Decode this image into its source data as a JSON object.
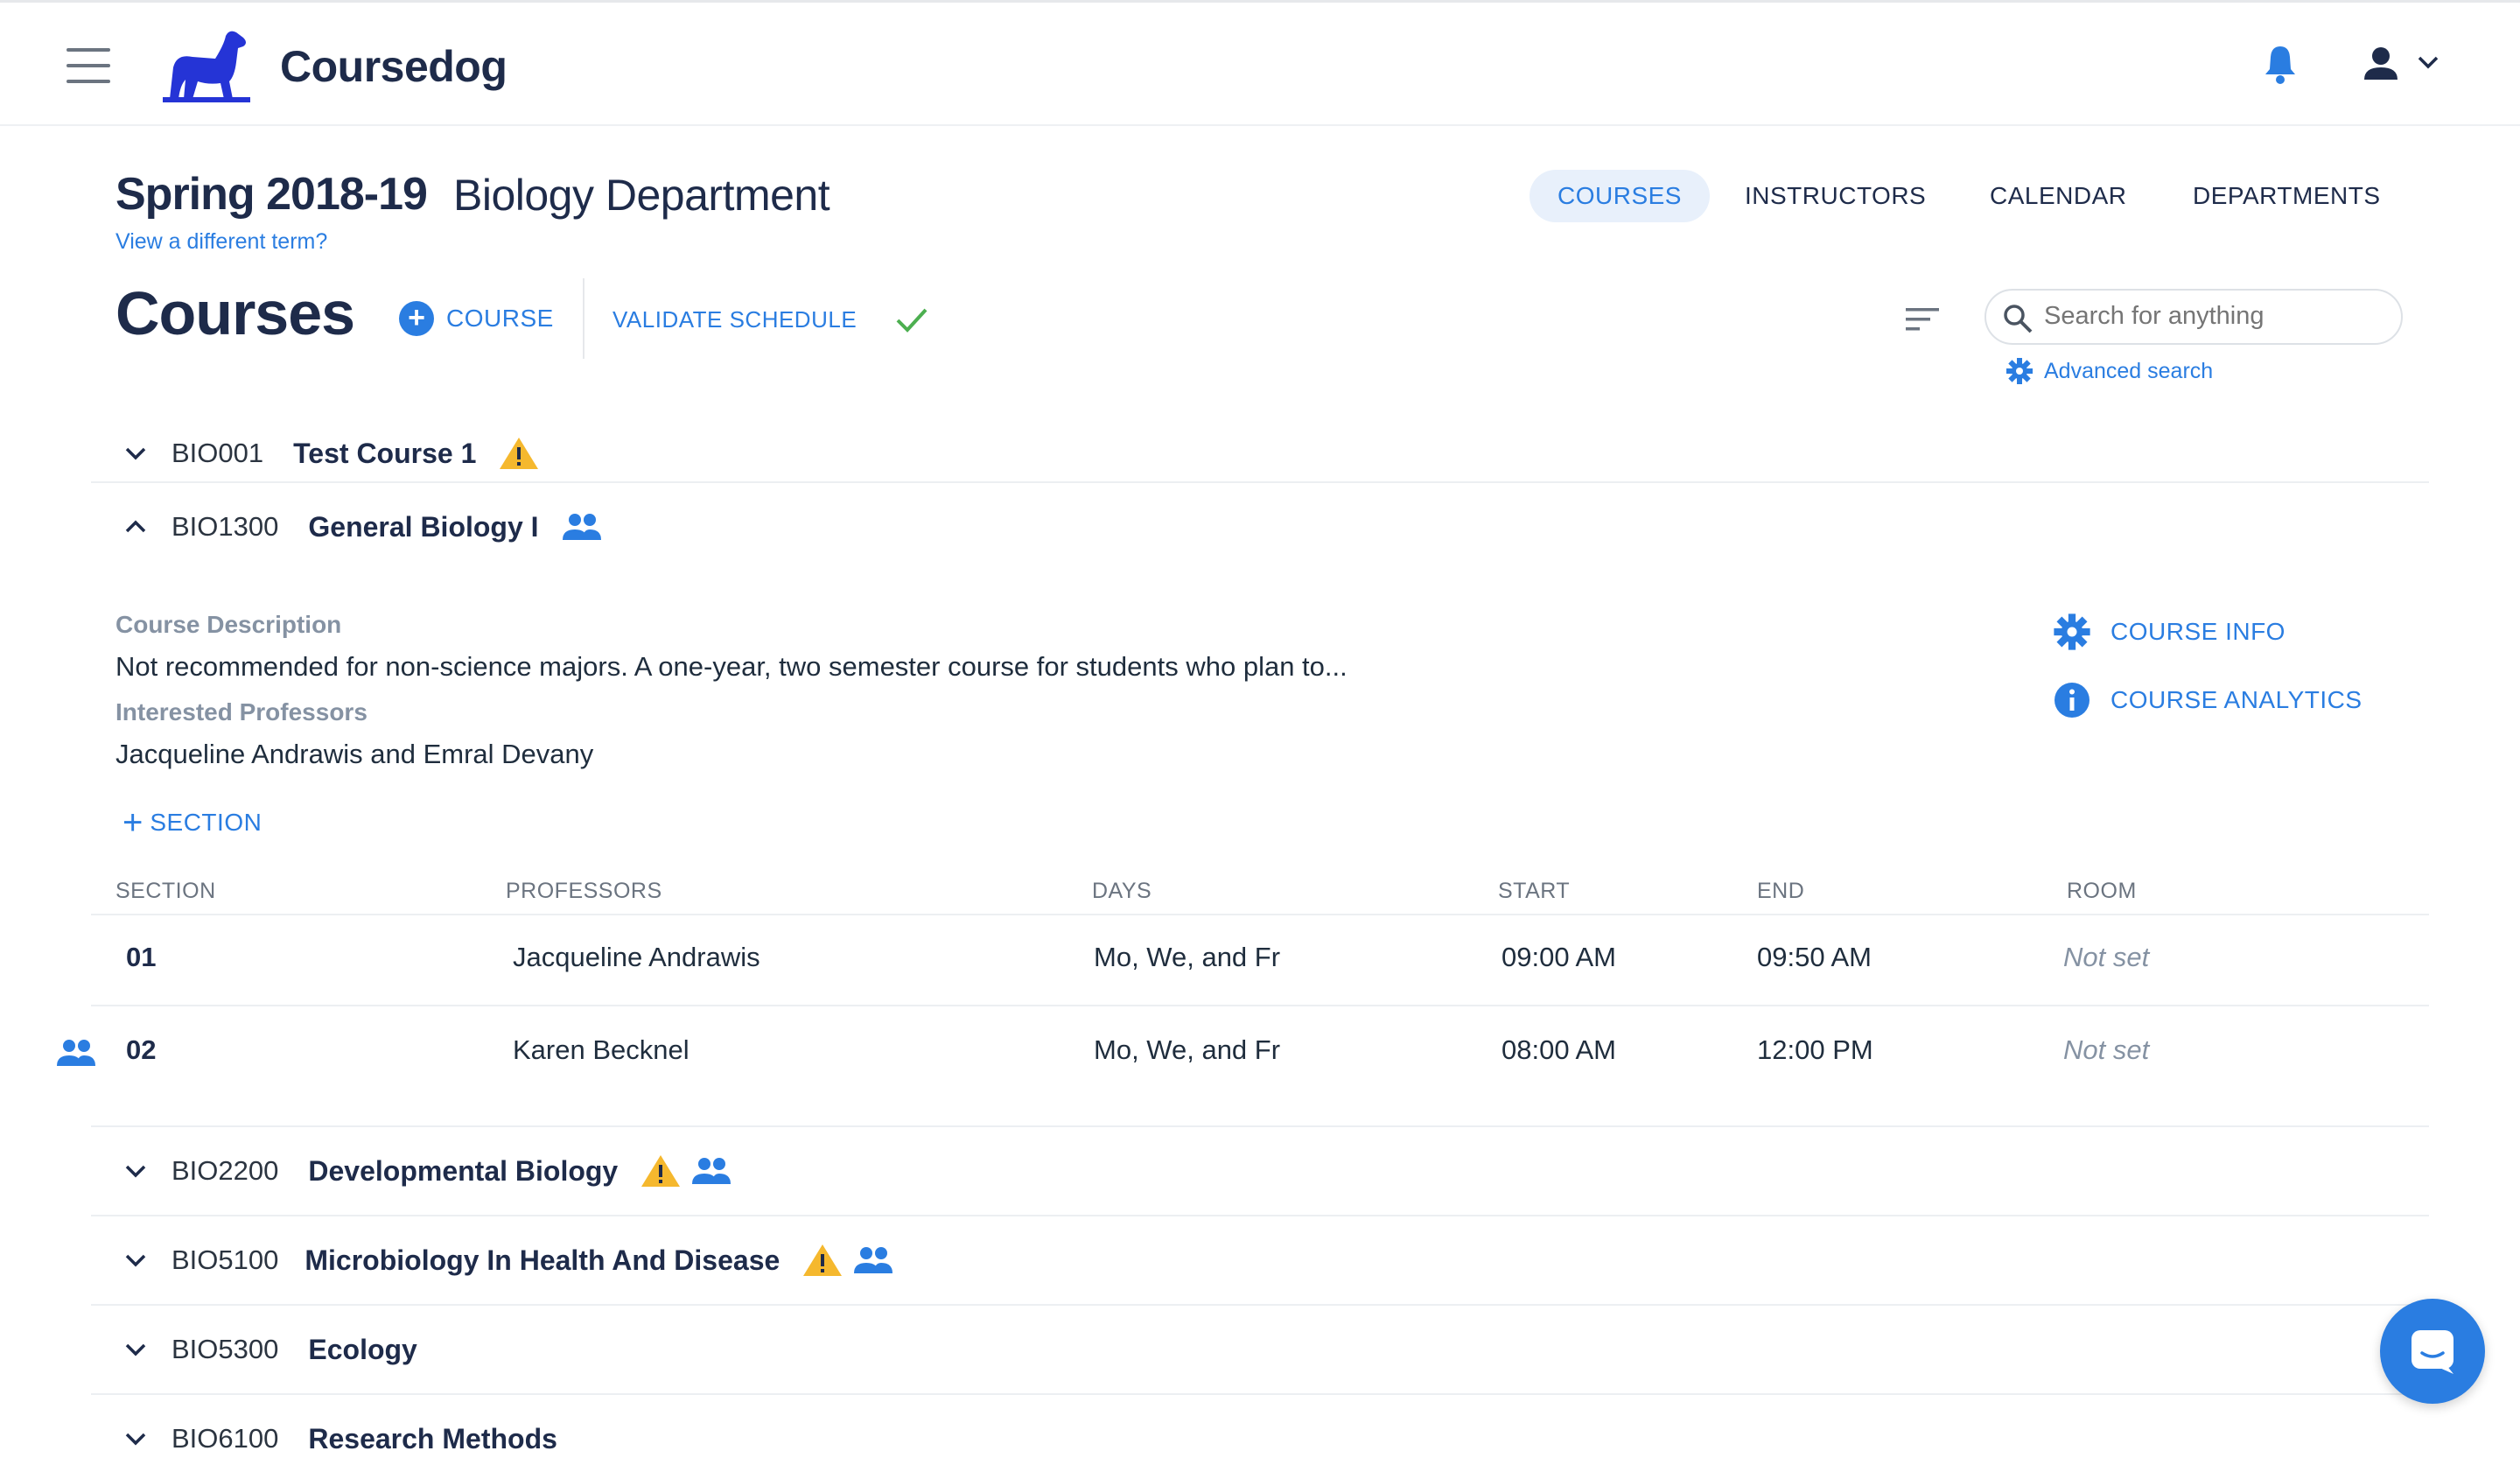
{
  "app": {
    "brand": "Coursedog"
  },
  "header": {
    "term": "Spring 2018-19",
    "department": "Biology Department",
    "change_term_link": "View a different term?",
    "nav": [
      "COURSES",
      "INSTRUCTORS",
      "CALENDAR",
      "DEPARTMENTS"
    ],
    "active_nav": "COURSES"
  },
  "toolbar": {
    "title": "Courses",
    "add_course_label": "COURSE",
    "validate_label": "VALIDATE SCHEDULE",
    "search_placeholder": "Search for anything",
    "advanced_search_label": "Advanced search"
  },
  "courses": [
    {
      "code": "BIO001",
      "name": "Test Course 1",
      "warning": true,
      "group": false,
      "expanded": false
    },
    {
      "code": "BIO1300",
      "name": "General Biology I",
      "warning": false,
      "group": true,
      "expanded": true
    },
    {
      "code": "BIO2200",
      "name": "Developmental Biology",
      "warning": true,
      "group": true,
      "expanded": false
    },
    {
      "code": "BIO5100",
      "name": "Microbiology In Health And Disease",
      "warning": true,
      "group": true,
      "expanded": false
    },
    {
      "code": "BIO5300",
      "name": "Ecology",
      "warning": false,
      "group": false,
      "expanded": false
    },
    {
      "code": "BIO6100",
      "name": "Research Methods",
      "warning": false,
      "group": false,
      "expanded": false
    }
  ],
  "expanded_course": {
    "description_label": "Course Description",
    "description": "Not recommended for non-science majors. A one-year, two semester course for students who plan to...",
    "professors_label": "Interested Professors",
    "professors": "Jacqueline Andrawis and Emral Devany",
    "course_info_label": "COURSE INFO",
    "course_analytics_label": "COURSE ANALYTICS",
    "add_section_label": "SECTION",
    "table": {
      "headers": [
        "SECTION",
        "PROFESSORS",
        "DAYS",
        "START",
        "END",
        "ROOM"
      ],
      "rows": [
        {
          "section": "01",
          "professor": "Jacqueline Andrawis",
          "days": "Mo, We, and Fr",
          "start": "09:00 AM",
          "end": "09:50 AM",
          "room": "Not set",
          "group": false
        },
        {
          "section": "02",
          "professor": "Karen Becknel",
          "days": "Mo, We, and Fr",
          "start": "08:00 AM",
          "end": "12:00 PM",
          "room": "Not set",
          "group": true
        }
      ]
    }
  },
  "colors": {
    "accent": "#2a7de1",
    "warning": "#f5b82e",
    "success": "#4caf50",
    "text_dark": "#1e2b4a"
  },
  "icons": [
    "menu-icon",
    "coursedog-logo",
    "bell-icon",
    "user-icon",
    "chevron-down-icon",
    "plus-circle-icon",
    "check-icon",
    "sort-icon",
    "search-icon",
    "gear-icon",
    "info-icon",
    "warning-icon",
    "group-icon",
    "chat-icon"
  ]
}
